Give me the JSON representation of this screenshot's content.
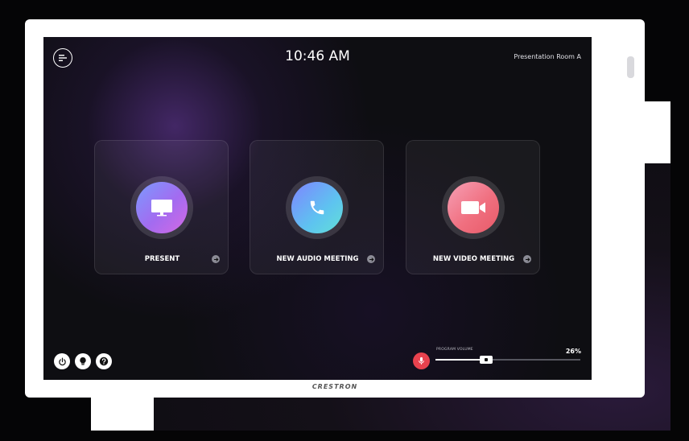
{
  "header": {
    "time": "10:46 AM",
    "room_name": "Presentation Room A"
  },
  "tiles": [
    {
      "label": "PRESENT",
      "icon": "display-icon"
    },
    {
      "label": "NEW AUDIO MEETING",
      "icon": "phone-icon"
    },
    {
      "label": "NEW VIDEO MEETING",
      "icon": "video-camera-icon"
    }
  ],
  "footer": {
    "buttons": [
      "power-icon",
      "lightbulb-icon",
      "help-icon"
    ],
    "mic_icon": "microphone-icon",
    "volume": {
      "label": "PROGRAM VOLUME",
      "value_text": "26%",
      "level": 0.35
    }
  },
  "device": {
    "brand": "CRESTRON"
  },
  "colors": {
    "mic_active": "#e8424e",
    "screen_bg": "#0e0e12"
  }
}
